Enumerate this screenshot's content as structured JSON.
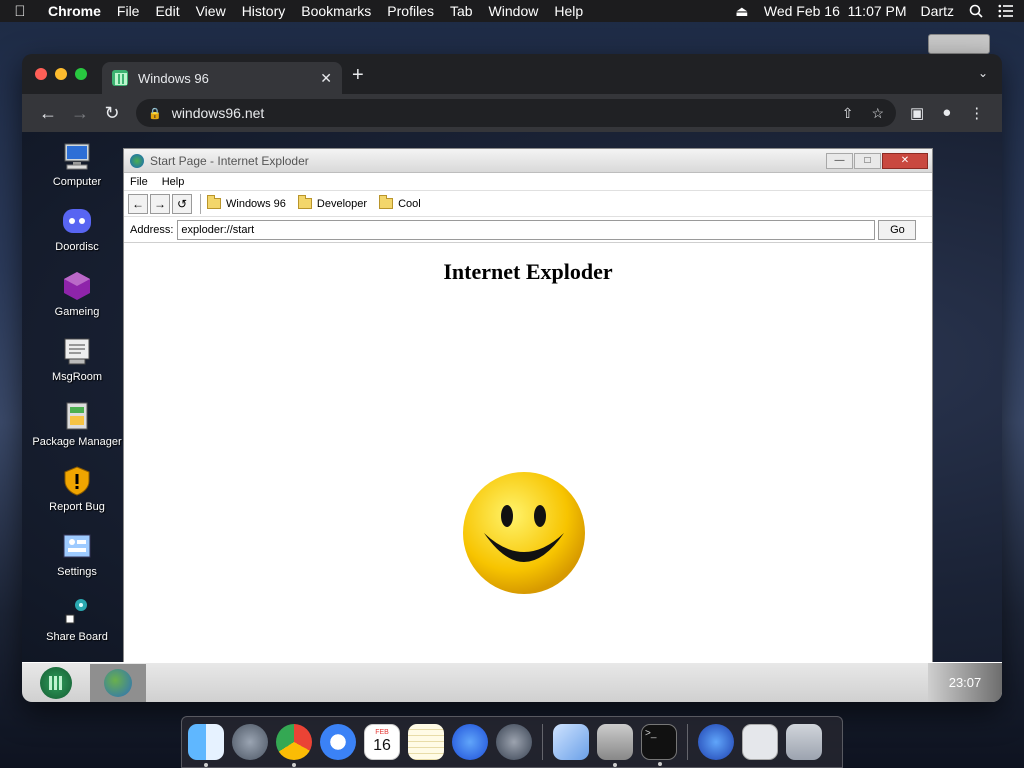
{
  "menubar": {
    "app": "Chrome",
    "items": [
      "File",
      "Edit",
      "View",
      "History",
      "Bookmarks",
      "Profiles",
      "Tab",
      "Window",
      "Help"
    ],
    "datetime": "Wed Feb 16  11:07 PM",
    "user": "Dartz"
  },
  "browser": {
    "tab_title": "Windows 96",
    "url": "windows96.net"
  },
  "desktop": {
    "icons": [
      {
        "label": "Computer"
      },
      {
        "label": "Doordisc"
      },
      {
        "label": "Gameing"
      },
      {
        "label": "MsgRoom"
      },
      {
        "label": "Package Manager"
      },
      {
        "label": "Report Bug"
      },
      {
        "label": "Settings"
      },
      {
        "label": "Share Board"
      }
    ]
  },
  "ie": {
    "title": "Start Page - Internet Exploder",
    "menu": [
      "File",
      "Help"
    ],
    "favorites": [
      "Windows 96",
      "Developer",
      "Cool"
    ],
    "address_label": "Address:",
    "address_value": "exploder://start",
    "go_label": "Go",
    "heading": "Internet Exploder"
  },
  "taskbar": {
    "clock": "23:07"
  },
  "dock": {
    "calendar_day": "16",
    "calendar_month": "FEB"
  },
  "colors": {
    "menubar_bg": "#1c1c1e",
    "chrome_bg": "#202124",
    "ie_close": "#c9483f"
  }
}
